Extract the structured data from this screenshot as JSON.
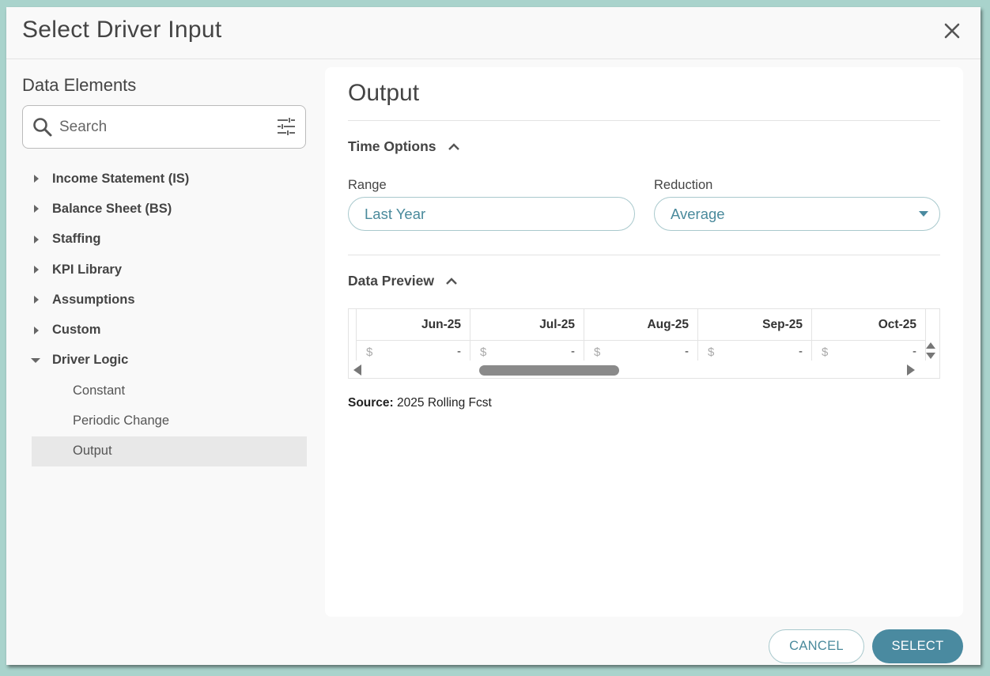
{
  "dialog": {
    "title": "Select Driver Input",
    "close_icon": "close-icon"
  },
  "left": {
    "heading": "Data Elements",
    "search": {
      "placeholder": "Search",
      "value": ""
    },
    "tree": [
      {
        "label": "Income Statement (IS)",
        "expanded": false
      },
      {
        "label": "Balance Sheet (BS)",
        "expanded": false
      },
      {
        "label": "Staffing",
        "expanded": false
      },
      {
        "label": "KPI Library",
        "expanded": false
      },
      {
        "label": "Assumptions",
        "expanded": false
      },
      {
        "label": "Custom",
        "expanded": false
      },
      {
        "label": "Driver Logic",
        "expanded": true
      }
    ],
    "sub_items": [
      {
        "label": "Constant"
      },
      {
        "label": "Periodic Change"
      },
      {
        "label": "Output",
        "selected": true
      }
    ]
  },
  "right": {
    "title": "Output",
    "time_options": {
      "heading": "Time Options",
      "range_label": "Range",
      "range_value": "Last Year",
      "reduction_label": "Reduction",
      "reduction_value": "Average"
    },
    "data_preview": {
      "heading": "Data Preview",
      "columns": [
        "Jun-25",
        "Jul-25",
        "Aug-25",
        "Sep-25",
        "Oct-25"
      ],
      "currency": "$",
      "values": [
        "-",
        "-",
        "-",
        "-",
        "-"
      ]
    },
    "source_label": "Source:",
    "source_value": "2025 Rolling Fcst"
  },
  "footer": {
    "cancel_label": "CANCEL",
    "select_label": "SELECT"
  },
  "colors": {
    "accent": "#4a8aa0",
    "accent_text": "#4a8a9c",
    "backdrop": "#a9d3cc"
  }
}
